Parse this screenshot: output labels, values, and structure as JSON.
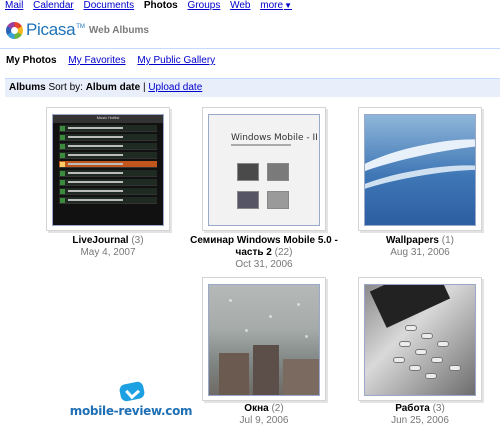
{
  "gbar": {
    "items": [
      "Mail",
      "Calendar",
      "Documents",
      "Photos",
      "Groups",
      "Web"
    ],
    "current": "Photos",
    "more_label": "more",
    "more_arrow": "▼"
  },
  "logo": {
    "name": "Picasa",
    "tm": "TM",
    "subtitle": "Web Albums"
  },
  "tabs": {
    "active": "My Photos",
    "favorites": "My Favorites",
    "public_gallery": "My Public Gallery"
  },
  "albums_bar": {
    "title": "Albums",
    "sort_label": "Sort by:",
    "sort_value": "Album date",
    "divider": "|",
    "upload_label": "Upload date"
  },
  "albums": [
    {
      "name": "LiveJournal",
      "count": "(3)",
      "date": "May 4, 2007"
    },
    {
      "name": "Семинар Windows Mobile 5.0 - часть 2",
      "count": "(22)",
      "date": "Oct 31, 2006"
    },
    {
      "name": "Wallpapers",
      "count": "(1)",
      "date": "Aug 31, 2006"
    },
    {
      "name": "Окна",
      "count": "(2)",
      "date": "Jul 9, 2006"
    },
    {
      "name": "Работа",
      "count": "(3)",
      "date": "Jun 25, 2006"
    }
  ],
  "thumb_texts": {
    "livejournal_header": "Music Hotlist",
    "wm_title": "Windows Mobile - II"
  },
  "watermark": {
    "text": "mobile-review.com"
  },
  "colors": {
    "link": "#0000cc",
    "bar_bg": "#e8eefa",
    "logo_blue": "#1d72b8"
  }
}
